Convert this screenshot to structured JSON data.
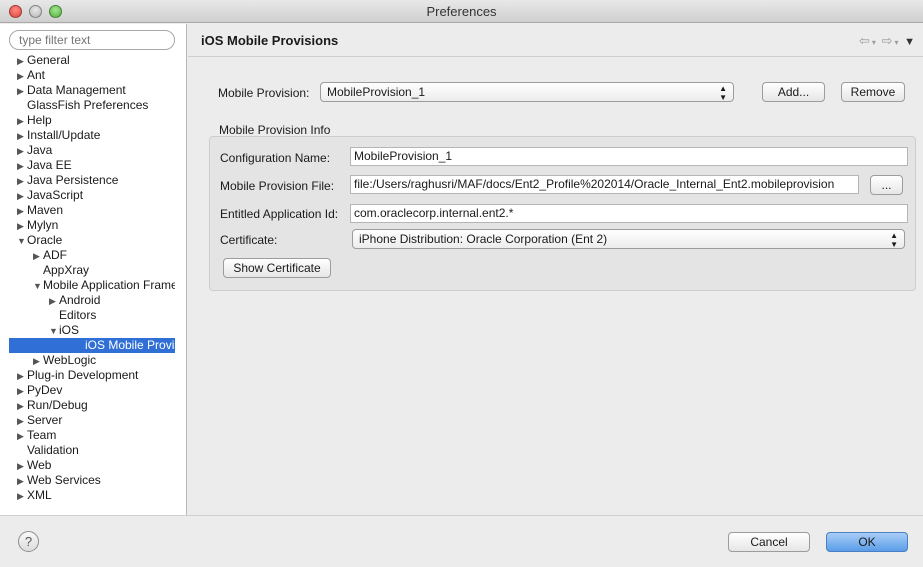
{
  "window": {
    "title": "Preferences"
  },
  "filter": {
    "placeholder": "type filter text"
  },
  "tree": [
    {
      "label": "General",
      "arrow": "▶",
      "indent": 0
    },
    {
      "label": "Ant",
      "arrow": "▶",
      "indent": 0
    },
    {
      "label": "Data Management",
      "arrow": "▶",
      "indent": 0
    },
    {
      "label": "GlassFish Preferences",
      "arrow": "",
      "indent": 0
    },
    {
      "label": "Help",
      "arrow": "▶",
      "indent": 0
    },
    {
      "label": "Install/Update",
      "arrow": "▶",
      "indent": 0
    },
    {
      "label": "Java",
      "arrow": "▶",
      "indent": 0
    },
    {
      "label": "Java EE",
      "arrow": "▶",
      "indent": 0
    },
    {
      "label": "Java Persistence",
      "arrow": "▶",
      "indent": 0
    },
    {
      "label": "JavaScript",
      "arrow": "▶",
      "indent": 0
    },
    {
      "label": "Maven",
      "arrow": "▶",
      "indent": 0
    },
    {
      "label": "Mylyn",
      "arrow": "▶",
      "indent": 0
    },
    {
      "label": "Oracle",
      "arrow": "▼",
      "indent": 0
    },
    {
      "label": "ADF",
      "arrow": "▶",
      "indent": 1
    },
    {
      "label": "AppXray",
      "arrow": "",
      "indent": 1
    },
    {
      "label": "Mobile Application Frame",
      "arrow": "▼",
      "indent": 1
    },
    {
      "label": "Android",
      "arrow": "▶",
      "indent": 2
    },
    {
      "label": "Editors",
      "arrow": "",
      "indent": 2
    },
    {
      "label": "iOS",
      "arrow": "▼",
      "indent": 2
    },
    {
      "label": "iOS Mobile Provisio",
      "arrow": "",
      "indent": 3,
      "selected": true
    },
    {
      "label": "WebLogic",
      "arrow": "▶",
      "indent": 1
    },
    {
      "label": "Plug-in Development",
      "arrow": "▶",
      "indent": 0
    },
    {
      "label": "PyDev",
      "arrow": "▶",
      "indent": 0
    },
    {
      "label": "Run/Debug",
      "arrow": "▶",
      "indent": 0
    },
    {
      "label": "Server",
      "arrow": "▶",
      "indent": 0
    },
    {
      "label": "Team",
      "arrow": "▶",
      "indent": 0
    },
    {
      "label": "Validation",
      "arrow": "",
      "indent": 0
    },
    {
      "label": "Web",
      "arrow": "▶",
      "indent": 0
    },
    {
      "label": "Web Services",
      "arrow": "▶",
      "indent": 0
    },
    {
      "label": "XML",
      "arrow": "▶",
      "indent": 0
    }
  ],
  "page": {
    "title": "iOS Mobile Provisions",
    "mobile_provision_label": "Mobile Provision:",
    "mobile_provision_value": "MobileProvision_1",
    "add_label": "Add...",
    "remove_label": "Remove",
    "group_label": "Mobile Provision Info",
    "config_name_label": "Configuration Name:",
    "config_name_value": "MobileProvision_1",
    "provision_file_label": "Mobile Provision File:",
    "provision_file_value": "file:/Users/raghusri/MAF/docs/Ent2_Profile%202014/Oracle_Internal_Ent2.mobileprovision",
    "browse_label": "...",
    "app_id_label": "Entitled Application Id:",
    "app_id_value": "com.oraclecorp.internal.ent2.*",
    "certificate_label": "Certificate:",
    "certificate_value": "iPhone Distribution: Oracle Corporation (Ent 2)",
    "show_cert_label": "Show Certificate"
  },
  "footer": {
    "help_glyph": "?",
    "cancel_label": "Cancel",
    "ok_label": "OK"
  },
  "colors": {
    "selection": "#2f6fd6",
    "ok_button": "#5a9de8"
  }
}
